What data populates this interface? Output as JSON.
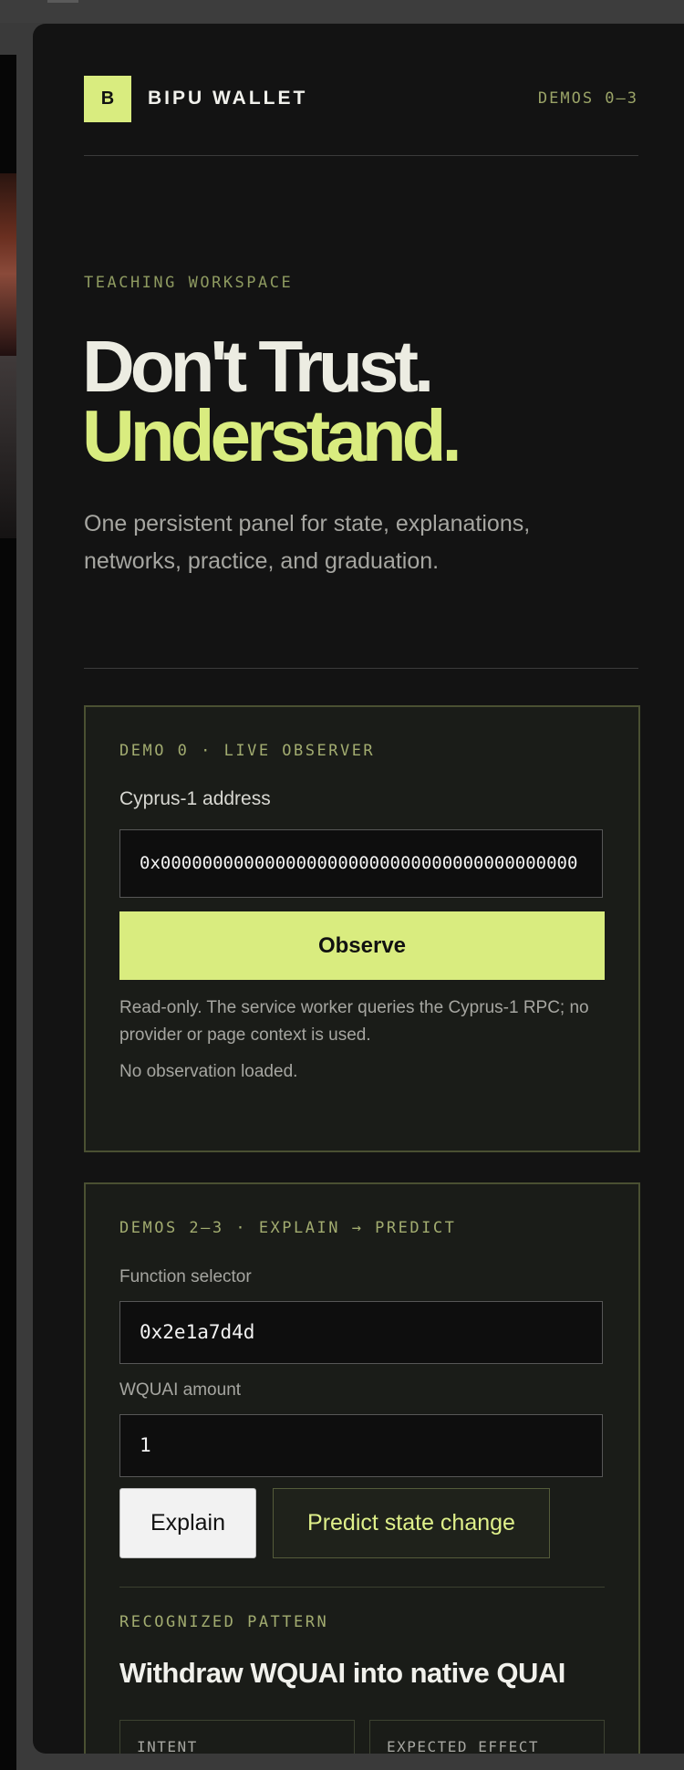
{
  "header": {
    "logo_letter": "B",
    "brand": "BIPU WALLET",
    "demos_label": "DEMOS 0–3"
  },
  "hero": {
    "eyebrow": "TEACHING WORKSPACE",
    "title_line1": "Don't Trust.",
    "title_line2": "Understand.",
    "lead": "One persistent panel for state, explanations, networks, practice, and graduation."
  },
  "demo0": {
    "label": "DEMO 0 · LIVE OBSERVER",
    "address_label": "Cyprus-1 address",
    "address_value": "0x0000000000000000000000000000000000000000",
    "observe_label": "Observe",
    "note": "Read-only. The service worker queries the Cyprus-1 RPC; no provider or page context is used.",
    "status": "No observation loaded."
  },
  "demo23": {
    "label": "DEMOS 2–3 · EXPLAIN → PREDICT",
    "selector_label": "Function selector",
    "selector_value": "0x2e1a7d4d",
    "amount_label": "WQUAI amount",
    "amount_value": "1",
    "explain_label": "Explain",
    "predict_label": "Predict state change",
    "pattern_label": "RECOGNIZED PATTERN",
    "pattern_title": "Withdraw WQUAI into native QUAI",
    "intent_label": "INTENT",
    "effect_label": "EXPECTED EFFECT"
  },
  "colors": {
    "accent": "#d9ec7f",
    "panel_bg": "#131313",
    "card_border": "#4a5032"
  }
}
